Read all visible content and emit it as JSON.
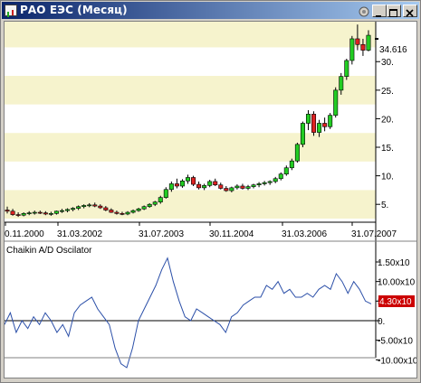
{
  "window": {
    "title": "РАО ЕЭС (Месяц)",
    "buttons": [
      "pin",
      "minimize",
      "maximize",
      "close"
    ]
  },
  "colors": {
    "band": "#f6f3cd",
    "up_candle": "#22cc22",
    "down_candle": "#dd2222",
    "oscillator_line": "#2b4fa8",
    "last_value_box": "#cc0000",
    "title_gradient_start": "#0a246a",
    "title_gradient_end": "#a6caf0"
  },
  "price_panel": {
    "last_price_label": "34.616",
    "y_ticks": [
      "5.",
      "10.",
      "15.",
      "20.",
      "25.",
      "30."
    ],
    "x_ticks": [
      "0.11.2000",
      "31.03.2002",
      "31.07.2003",
      "30.11.2004",
      "31.03.2006",
      "31.07.2007"
    ]
  },
  "oscillator_panel": {
    "title": "Chaikin A/D Oscilator",
    "y_ticks": [
      "1.50x10",
      "10.00x10",
      "5.00x10",
      "0.",
      "-5.00x10",
      "-10.00x10"
    ],
    "last_value_label": "4.30x10"
  },
  "chart_data": [
    {
      "type": "candlestick",
      "title": "РАО ЕЭС (Месяц)",
      "ylim": [
        2.5,
        37
      ],
      "x_range": [
        "30.11.2000",
        "31.07.2007"
      ],
      "candles": [
        {
          "o": 4.0,
          "h": 4.6,
          "l": 3.4,
          "c": 3.8
        },
        {
          "o": 3.8,
          "h": 4.2,
          "l": 3.0,
          "c": 3.2
        },
        {
          "o": 3.2,
          "h": 3.6,
          "l": 2.8,
          "c": 3.1
        },
        {
          "o": 3.1,
          "h": 3.6,
          "l": 2.9,
          "c": 3.4
        },
        {
          "o": 3.4,
          "h": 3.8,
          "l": 3.1,
          "c": 3.5
        },
        {
          "o": 3.5,
          "h": 3.9,
          "l": 3.2,
          "c": 3.6
        },
        {
          "o": 3.6,
          "h": 3.9,
          "l": 3.3,
          "c": 3.5
        },
        {
          "o": 3.5,
          "h": 3.8,
          "l": 3.1,
          "c": 3.3
        },
        {
          "o": 3.3,
          "h": 3.7,
          "l": 3.0,
          "c": 3.4
        },
        {
          "o": 3.4,
          "h": 3.9,
          "l": 3.2,
          "c": 3.8
        },
        {
          "o": 3.8,
          "h": 4.2,
          "l": 3.5,
          "c": 3.9
        },
        {
          "o": 3.9,
          "h": 4.3,
          "l": 3.6,
          "c": 4.1
        },
        {
          "o": 4.1,
          "h": 4.5,
          "l": 3.8,
          "c": 4.3
        },
        {
          "o": 4.3,
          "h": 4.8,
          "l": 4.0,
          "c": 4.6
        },
        {
          "o": 4.6,
          "h": 5.0,
          "l": 4.3,
          "c": 4.8
        },
        {
          "o": 4.8,
          "h": 5.2,
          "l": 4.5,
          "c": 4.9
        },
        {
          "o": 4.9,
          "h": 5.3,
          "l": 4.5,
          "c": 4.7
        },
        {
          "o": 4.7,
          "h": 5.0,
          "l": 4.2,
          "c": 4.4
        },
        {
          "o": 4.4,
          "h": 4.7,
          "l": 3.8,
          "c": 4.0
        },
        {
          "o": 4.0,
          "h": 4.3,
          "l": 3.5,
          "c": 3.6
        },
        {
          "o": 3.6,
          "h": 3.9,
          "l": 3.2,
          "c": 3.4
        },
        {
          "o": 3.4,
          "h": 3.7,
          "l": 3.1,
          "c": 3.3
        },
        {
          "o": 3.3,
          "h": 3.8,
          "l": 3.1,
          "c": 3.6
        },
        {
          "o": 3.6,
          "h": 4.1,
          "l": 3.4,
          "c": 3.9
        },
        {
          "o": 3.9,
          "h": 4.4,
          "l": 3.7,
          "c": 4.2
        },
        {
          "o": 4.2,
          "h": 4.8,
          "l": 4.0,
          "c": 4.6
        },
        {
          "o": 4.6,
          "h": 5.2,
          "l": 4.4,
          "c": 5.0
        },
        {
          "o": 5.0,
          "h": 5.6,
          "l": 4.7,
          "c": 5.4
        },
        {
          "o": 5.4,
          "h": 6.5,
          "l": 5.1,
          "c": 6.2
        },
        {
          "o": 6.2,
          "h": 8.0,
          "l": 6.0,
          "c": 7.6
        },
        {
          "o": 7.6,
          "h": 9.0,
          "l": 7.2,
          "c": 8.6
        },
        {
          "o": 8.6,
          "h": 9.5,
          "l": 7.8,
          "c": 8.2
        },
        {
          "o": 8.2,
          "h": 9.4,
          "l": 7.9,
          "c": 9.1
        },
        {
          "o": 9.1,
          "h": 10.2,
          "l": 8.6,
          "c": 9.7
        },
        {
          "o": 9.7,
          "h": 10.0,
          "l": 8.2,
          "c": 8.5
        },
        {
          "o": 8.5,
          "h": 9.0,
          "l": 7.6,
          "c": 7.9
        },
        {
          "o": 7.9,
          "h": 8.6,
          "l": 7.5,
          "c": 8.3
        },
        {
          "o": 8.3,
          "h": 9.3,
          "l": 8.0,
          "c": 9.0
        },
        {
          "o": 9.0,
          "h": 9.5,
          "l": 8.2,
          "c": 8.4
        },
        {
          "o": 8.4,
          "h": 8.8,
          "l": 7.6,
          "c": 7.8
        },
        {
          "o": 7.8,
          "h": 8.2,
          "l": 7.2,
          "c": 7.4
        },
        {
          "o": 7.4,
          "h": 8.1,
          "l": 7.1,
          "c": 7.9
        },
        {
          "o": 7.9,
          "h": 8.5,
          "l": 7.6,
          "c": 8.2
        },
        {
          "o": 8.2,
          "h": 8.6,
          "l": 7.6,
          "c": 7.8
        },
        {
          "o": 7.8,
          "h": 8.4,
          "l": 7.5,
          "c": 8.1
        },
        {
          "o": 8.1,
          "h": 8.6,
          "l": 7.8,
          "c": 8.4
        },
        {
          "o": 8.4,
          "h": 8.9,
          "l": 8.0,
          "c": 8.6
        },
        {
          "o": 8.6,
          "h": 9.1,
          "l": 8.3,
          "c": 8.8
        },
        {
          "o": 8.8,
          "h": 9.2,
          "l": 8.4,
          "c": 9.0
        },
        {
          "o": 9.0,
          "h": 9.8,
          "l": 8.7,
          "c": 9.5
        },
        {
          "o": 9.5,
          "h": 10.6,
          "l": 9.2,
          "c": 10.3
        },
        {
          "o": 10.3,
          "h": 11.8,
          "l": 10.0,
          "c": 11.4
        },
        {
          "o": 11.4,
          "h": 13.0,
          "l": 11.0,
          "c": 12.6
        },
        {
          "o": 12.6,
          "h": 15.8,
          "l": 12.3,
          "c": 15.5
        },
        {
          "o": 15.5,
          "h": 19.5,
          "l": 15.0,
          "c": 19.2
        },
        {
          "o": 19.2,
          "h": 21.5,
          "l": 18.0,
          "c": 20.8
        },
        {
          "o": 20.8,
          "h": 21.3,
          "l": 17.0,
          "c": 17.6
        },
        {
          "o": 17.6,
          "h": 19.8,
          "l": 16.8,
          "c": 19.2
        },
        {
          "o": 19.2,
          "h": 20.2,
          "l": 17.8,
          "c": 18.6
        },
        {
          "o": 18.6,
          "h": 21.0,
          "l": 18.2,
          "c": 20.6
        },
        {
          "o": 20.6,
          "h": 25.5,
          "l": 20.2,
          "c": 25.0
        },
        {
          "o": 25.0,
          "h": 28.0,
          "l": 24.2,
          "c": 27.4
        },
        {
          "o": 27.4,
          "h": 30.5,
          "l": 26.8,
          "c": 30.2
        },
        {
          "o": 30.2,
          "h": 34.5,
          "l": 29.5,
          "c": 34.0
        },
        {
          "o": 34.0,
          "h": 36.5,
          "l": 32.0,
          "c": 33.0
        },
        {
          "o": 33.0,
          "h": 34.0,
          "l": 31.0,
          "c": 32.0
        },
        {
          "o": 32.0,
          "h": 35.5,
          "l": 31.8,
          "c": 34.616
        }
      ]
    },
    {
      "type": "line",
      "title": "Chaikin A/D Oscilator",
      "ylim": [
        -12,
        17
      ],
      "series": [
        {
          "values": [
            -1,
            2,
            -3,
            0,
            -2,
            1,
            -1,
            2,
            0,
            -3,
            -1,
            -4,
            2,
            4,
            5,
            6,
            3,
            1,
            -1,
            -7,
            -11,
            -12,
            -7,
            0,
            3,
            6,
            9,
            13,
            16,
            10,
            5,
            1,
            0,
            3,
            2,
            1,
            0,
            -1,
            -3,
            1,
            2,
            4,
            5,
            6,
            6,
            9,
            8,
            10,
            7,
            8,
            6,
            6,
            7,
            6,
            8,
            9,
            8,
            12,
            10,
            7,
            10,
            8,
            5,
            4.3
          ]
        }
      ]
    }
  ]
}
